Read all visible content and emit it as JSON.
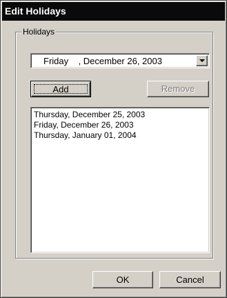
{
  "window": {
    "title": "Edit Holidays"
  },
  "group": {
    "label": "Holidays"
  },
  "date_picker": {
    "value": "Friday    , December 26, 2003"
  },
  "buttons": {
    "add": "Add",
    "remove": "Remove",
    "ok": "OK",
    "cancel": "Cancel"
  },
  "holiday_list": {
    "items": [
      "Thursday, December 25, 2003",
      "Friday, December 26, 2003",
      "Thursday, January 01, 2004"
    ]
  }
}
